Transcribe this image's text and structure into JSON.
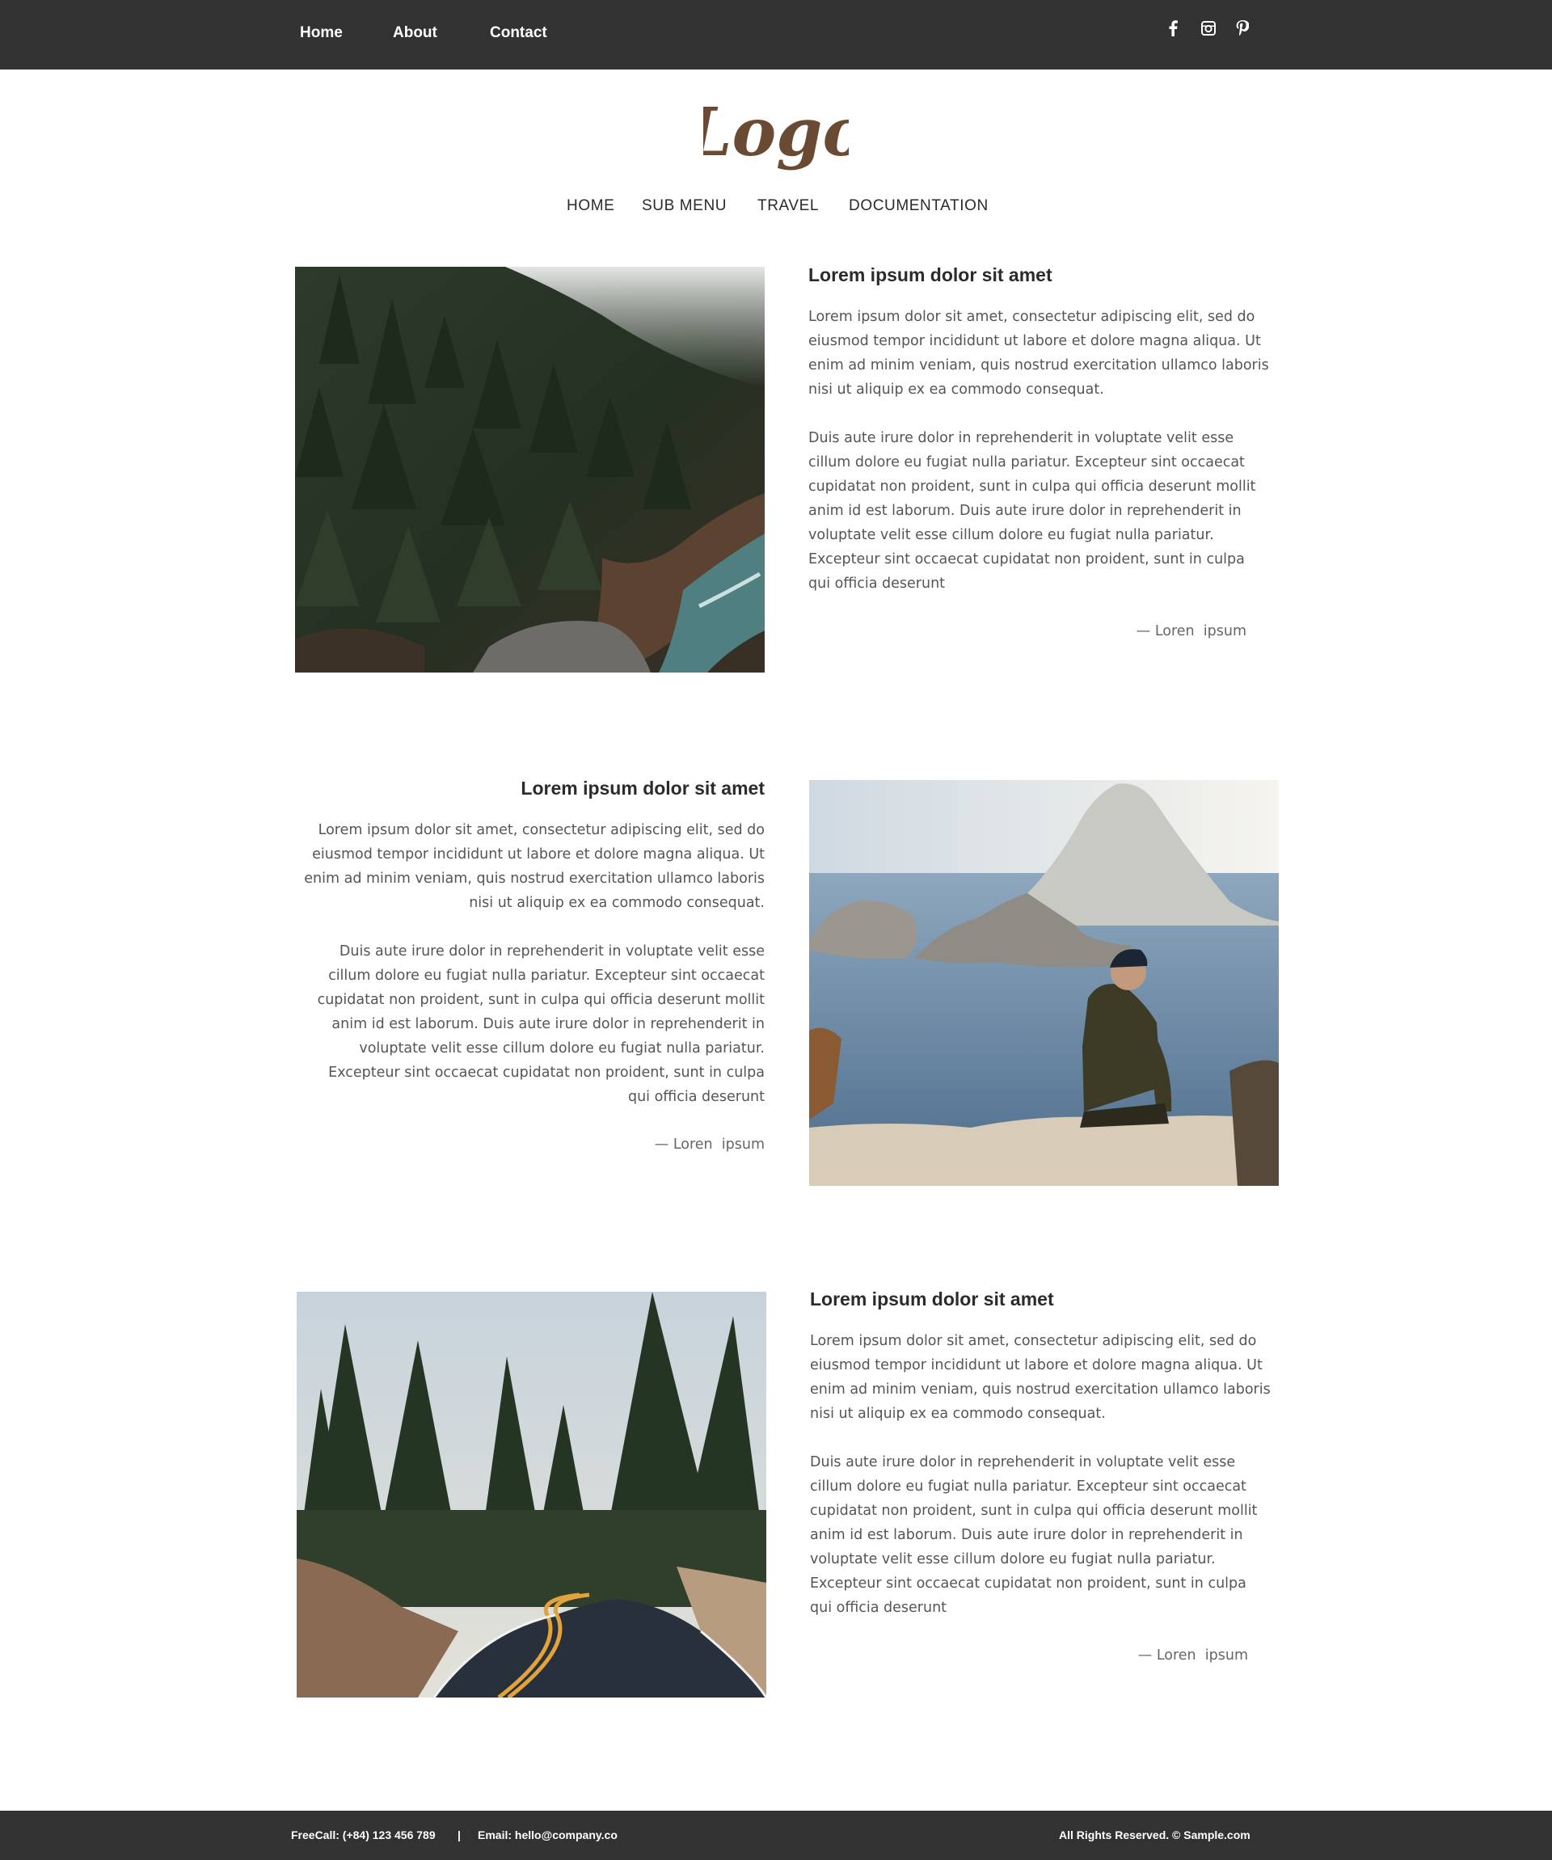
{
  "top_nav": {
    "items": [
      "Home",
      "About",
      "Contact"
    ]
  },
  "social": {
    "icons": [
      "facebook-icon",
      "instagram-icon",
      "pinterest-icon"
    ]
  },
  "logo": {
    "text": "Logo",
    "color": "#6b4a34"
  },
  "main_nav": {
    "items": [
      "HOME",
      "SUB MENU",
      "TRAVEL",
      "DOCUMENTATION"
    ]
  },
  "articles": [
    {
      "title": "Lorem ipsum dolor sit amet",
      "para1": "Lorem ipsum dolor sit amet, consectetur adipiscing elit, sed do eiusmod tempor incididunt ut labore et dolore magna aliqua. Ut enim ad minim veniam, quis nostrud exercitation ullamco laboris nisi ut aliquip ex ea commodo consequat.",
      "para2": "Duis aute irure dolor in reprehenderit in voluptate velit esse cillum dolore eu fugiat nulla pariatur. Excepteur sint occaecat cupidatat non proident, sunt in culpa qui officia deserunt mollit anim id est laborum. Duis aute irure dolor in reprehenderit in voluptate velit esse cillum dolore eu fugiat nulla pariatur. Excepteur sint occaecat cupidatat non proident, sunt in culpa qui officia deserunt",
      "signature": "— Loren  ipsum",
      "image": "forest-river-photo"
    },
    {
      "title": "Lorem ipsum dolor sit amet",
      "para1": "Lorem ipsum dolor sit amet, consectetur adipiscing elit, sed do eiusmod tempor incididunt ut labore et dolore magna aliqua. Ut enim ad minim veniam, quis nostrud exercitation ullamco laboris nisi ut aliquip ex ea commodo consequat.",
      "para2": "Duis aute irure dolor in reprehenderit in voluptate velit esse cillum dolore eu fugiat nulla pariatur. Excepteur sint occaecat cupidatat non proident, sunt in culpa qui officia deserunt mollit anim id est laborum. Duis aute irure dolor in reprehenderit in voluptate velit esse cillum dolore eu fugiat nulla pariatur. Excepteur sint occaecat cupidatat non proident, sunt in culpa qui officia deserunt",
      "signature": "— Loren  ipsum",
      "image": "man-sea-cliff-photo"
    },
    {
      "title": "Lorem ipsum dolor sit amet",
      "para1": "Lorem ipsum dolor sit amet, consectetur adipiscing elit, sed do eiusmod tempor incididunt ut labore et dolore magna aliqua. Ut enim ad minim veniam, quis nostrud exercitation ullamco laboris nisi ut aliquip ex ea commodo consequat.",
      "para2": "Duis aute irure dolor in reprehenderit in voluptate velit esse cillum dolore eu fugiat nulla pariatur. Excepteur sint occaecat cupidatat non proident, sunt in culpa qui officia deserunt mollit anim id est laborum. Duis aute irure dolor in reprehenderit in voluptate velit esse cillum dolore eu fugiat nulla pariatur. Excepteur sint occaecat cupidatat non proident, sunt in culpa qui officia deserunt",
      "signature": "— Loren  ipsum",
      "image": "forest-road-photo"
    }
  ],
  "footer": {
    "phone": "FreeCall: (+84) 123 456 789",
    "separator": "|",
    "email": "Email: hello@company.co",
    "copyright": "All Rights Reserved. © Sample.com"
  },
  "colors": {
    "bar": "#323232",
    "text_dark": "#2b2b2b",
    "text_body": "#555555"
  }
}
